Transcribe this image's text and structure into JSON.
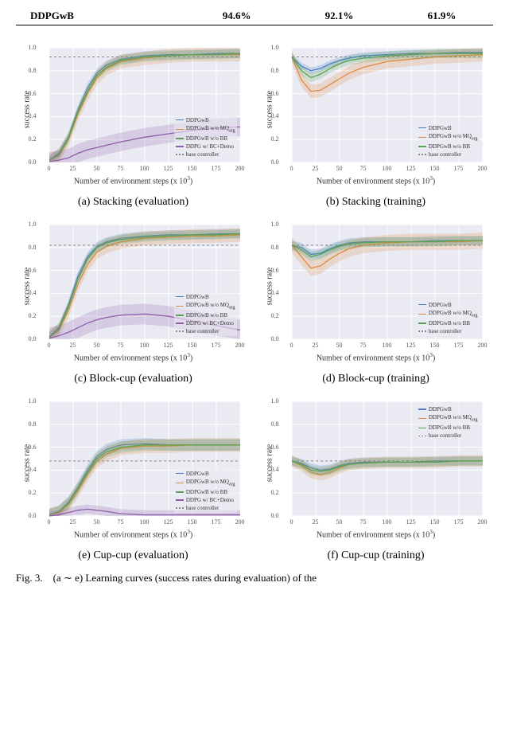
{
  "table": {
    "row1": {
      "label": "DDPGwB",
      "c1": "94.6%",
      "c2": "92.1%",
      "c3": "61.9%"
    }
  },
  "figure_caption_prefix": "Fig. 3.",
  "figure_caption_body": "(a ∼ e) Learning curves (success rates during evaluation) of the",
  "colors": {
    "DDPGwB": "#4a7ec9",
    "DDPGwB_noMQ": "#e08a3d",
    "DDPGwB_noBB": "#5aa253",
    "DDPG_BC": "#8f5eaa",
    "base": "#8a8a8a"
  },
  "legend_labels": {
    "DDPGwB": "DDPGwB",
    "noMQ_1": "DDPGwB w/o MQ",
    "noMQ_suffix": "arg",
    "noBB": "DDPGwB w/o BB",
    "BC": "DDPG w/ BC+Demo",
    "base": "base controller"
  },
  "axis": {
    "ylabel": "success rate",
    "xlabel_1": "Number of environment steps (x 10",
    "xlabel_sup": "3",
    "xlabel_2": ")",
    "yticks": [
      "0.0",
      "0.2",
      "0.4",
      "0.6",
      "0.8",
      "1.0"
    ],
    "xticks": [
      "0",
      "25",
      "50",
      "75",
      "100",
      "125",
      "150",
      "175",
      "200"
    ]
  },
  "chart_data": [
    {
      "id": "a",
      "caption": "(a) Stacking (evaluation)",
      "type": "line",
      "ylim": [
        0,
        1
      ],
      "xlim": [
        0,
        200
      ],
      "base": 0.92,
      "legend_pos": "lower-right",
      "legend_set": "full",
      "x": [
        0,
        10,
        20,
        30,
        40,
        50,
        60,
        75,
        100,
        125,
        150,
        175,
        200
      ],
      "series": [
        {
          "name": "DDPGwB",
          "key": "DDPGwB",
          "values": [
            0.02,
            0.08,
            0.22,
            0.46,
            0.65,
            0.78,
            0.85,
            0.9,
            0.93,
            0.94,
            0.94,
            0.95,
            0.95
          ],
          "band": 0.04
        },
        {
          "name": "DDPGwB w/o MQ_arg",
          "key": "DDPGwB_noMQ",
          "values": [
            0.02,
            0.06,
            0.2,
            0.42,
            0.6,
            0.74,
            0.82,
            0.88,
            0.91,
            0.93,
            0.94,
            0.94,
            0.94
          ],
          "band": 0.06
        },
        {
          "name": "DDPGwB w/o BB",
          "key": "DDPGwB_noBB",
          "values": [
            0.02,
            0.07,
            0.21,
            0.44,
            0.62,
            0.76,
            0.83,
            0.89,
            0.92,
            0.93,
            0.94,
            0.94,
            0.95
          ],
          "band": 0.04
        },
        {
          "name": "DDPG w/ BC+Demo",
          "key": "DDPG_BC",
          "values": [
            0.01,
            0.02,
            0.04,
            0.08,
            0.11,
            0.13,
            0.15,
            0.18,
            0.22,
            0.25,
            0.28,
            0.3,
            0.31
          ],
          "band": 0.08
        }
      ]
    },
    {
      "id": "b",
      "caption": "(b) Stacking (training)",
      "type": "line",
      "ylim": [
        0,
        1
      ],
      "xlim": [
        0,
        200
      ],
      "base": 0.92,
      "legend_pos": "lower-right",
      "legend_set": "ablate",
      "x": [
        0,
        10,
        20,
        30,
        40,
        50,
        60,
        75,
        100,
        125,
        150,
        175,
        200
      ],
      "series": [
        {
          "name": "DDPGwB",
          "key": "DDPGwB",
          "values": [
            0.92,
            0.84,
            0.8,
            0.82,
            0.86,
            0.89,
            0.91,
            0.93,
            0.94,
            0.95,
            0.95,
            0.96,
            0.96
          ],
          "band": 0.03
        },
        {
          "name": "DDPGwB w/o MQ_arg",
          "key": "DDPGwB_noMQ",
          "values": [
            0.92,
            0.72,
            0.62,
            0.63,
            0.68,
            0.73,
            0.78,
            0.83,
            0.88,
            0.9,
            0.92,
            0.93,
            0.94
          ],
          "band": 0.06
        },
        {
          "name": "DDPGwB w/o BB",
          "key": "DDPGwB_noBB",
          "values": [
            0.92,
            0.8,
            0.74,
            0.77,
            0.82,
            0.86,
            0.89,
            0.91,
            0.93,
            0.94,
            0.95,
            0.95,
            0.95
          ],
          "band": 0.04
        }
      ]
    },
    {
      "id": "c",
      "caption": "(c) Block-cup (evaluation)",
      "type": "line",
      "ylim": [
        0,
        1
      ],
      "xlim": [
        0,
        200
      ],
      "base": 0.82,
      "legend_pos": "lower-right",
      "legend_set": "full",
      "x": [
        0,
        10,
        20,
        30,
        40,
        50,
        60,
        75,
        100,
        125,
        150,
        175,
        200
      ],
      "series": [
        {
          "name": "DDPGwB",
          "key": "DDPGwB",
          "values": [
            0.02,
            0.1,
            0.3,
            0.55,
            0.72,
            0.81,
            0.85,
            0.88,
            0.9,
            0.91,
            0.91,
            0.92,
            0.92
          ],
          "band": 0.04
        },
        {
          "name": "DDPGwB w/o MQ_arg",
          "key": "DDPGwB_noMQ",
          "values": [
            0.02,
            0.08,
            0.25,
            0.48,
            0.65,
            0.76,
            0.81,
            0.85,
            0.88,
            0.89,
            0.9,
            0.9,
            0.91
          ],
          "band": 0.06
        },
        {
          "name": "DDPGwB w/o BB",
          "key": "DDPGwB_noBB",
          "values": [
            0.02,
            0.09,
            0.28,
            0.52,
            0.7,
            0.8,
            0.84,
            0.87,
            0.89,
            0.9,
            0.91,
            0.91,
            0.92
          ],
          "band": 0.04
        },
        {
          "name": "DDPG w/ BC+Demo",
          "key": "DDPG_BC",
          "values": [
            0.01,
            0.03,
            0.06,
            0.1,
            0.14,
            0.17,
            0.19,
            0.21,
            0.22,
            0.2,
            0.16,
            0.12,
            0.08
          ],
          "band": 0.09
        }
      ]
    },
    {
      "id": "d",
      "caption": "(d) Block-cup (training)",
      "type": "line",
      "ylim": [
        0,
        1
      ],
      "xlim": [
        0,
        200
      ],
      "base": 0.82,
      "legend_pos": "lower-right",
      "legend_set": "ablate",
      "x": [
        0,
        10,
        20,
        30,
        40,
        50,
        60,
        75,
        100,
        125,
        150,
        175,
        200
      ],
      "series": [
        {
          "name": "DDPGwB",
          "key": "DDPGwB",
          "values": [
            0.82,
            0.8,
            0.74,
            0.75,
            0.79,
            0.82,
            0.84,
            0.85,
            0.85,
            0.85,
            0.86,
            0.86,
            0.86
          ],
          "band": 0.04
        },
        {
          "name": "DDPGwB w/o MQ_arg",
          "key": "DDPGwB_noMQ",
          "values": [
            0.82,
            0.72,
            0.62,
            0.64,
            0.7,
            0.75,
            0.79,
            0.82,
            0.84,
            0.85,
            0.85,
            0.85,
            0.86
          ],
          "band": 0.07
        },
        {
          "name": "DDPGwB w/o BB",
          "key": "DDPGwB_noBB",
          "values": [
            0.82,
            0.78,
            0.72,
            0.74,
            0.78,
            0.81,
            0.83,
            0.84,
            0.85,
            0.85,
            0.85,
            0.86,
            0.86
          ],
          "band": 0.04
        }
      ]
    },
    {
      "id": "e",
      "caption": "(e) Cup-cup (evaluation)",
      "type": "line",
      "ylim": [
        0,
        1
      ],
      "xlim": [
        0,
        200
      ],
      "base": 0.48,
      "legend_pos": "lower-right",
      "legend_set": "full",
      "x": [
        0,
        10,
        20,
        30,
        40,
        50,
        60,
        75,
        100,
        125,
        150,
        175,
        200
      ],
      "series": [
        {
          "name": "DDPGwB",
          "key": "DDPGwB",
          "values": [
            0.01,
            0.04,
            0.12,
            0.25,
            0.4,
            0.52,
            0.58,
            0.62,
            0.63,
            0.62,
            0.62,
            0.62,
            0.62
          ],
          "band": 0.05
        },
        {
          "name": "DDPGwB w/o MQ_arg",
          "key": "DDPGwB_noMQ",
          "values": [
            0.01,
            0.03,
            0.1,
            0.22,
            0.36,
            0.48,
            0.54,
            0.59,
            0.61,
            0.61,
            0.62,
            0.62,
            0.62
          ],
          "band": 0.06
        },
        {
          "name": "DDPGwB w/o BB",
          "key": "DDPGwB_noBB",
          "values": [
            0.01,
            0.04,
            0.11,
            0.24,
            0.38,
            0.5,
            0.56,
            0.6,
            0.62,
            0.62,
            0.62,
            0.62,
            0.62
          ],
          "band": 0.05
        },
        {
          "name": "DDPG w/ BC+Demo",
          "key": "DDPG_BC",
          "values": [
            0.0,
            0.01,
            0.03,
            0.05,
            0.06,
            0.05,
            0.04,
            0.02,
            0.01,
            0.01,
            0.01,
            0.01,
            0.01
          ],
          "band": 0.04
        }
      ]
    },
    {
      "id": "f",
      "caption": "(f) Cup-cup (training)",
      "type": "line",
      "ylim": [
        0,
        1
      ],
      "xlim": [
        0,
        200
      ],
      "base": 0.48,
      "legend_pos": "upper-right",
      "legend_set": "ablate",
      "x": [
        0,
        10,
        20,
        30,
        40,
        50,
        60,
        75,
        100,
        125,
        150,
        175,
        200
      ],
      "series": [
        {
          "name": "DDPGwB",
          "key": "DDPGwB",
          "values": [
            0.48,
            0.46,
            0.42,
            0.4,
            0.41,
            0.44,
            0.46,
            0.47,
            0.47,
            0.47,
            0.48,
            0.48,
            0.48
          ],
          "band": 0.04
        },
        {
          "name": "DDPGwB w/o MQ_arg",
          "key": "DDPGwB_noMQ",
          "values": [
            0.48,
            0.44,
            0.38,
            0.36,
            0.38,
            0.42,
            0.45,
            0.46,
            0.47,
            0.47,
            0.47,
            0.48,
            0.48
          ],
          "band": 0.05
        },
        {
          "name": "DDPGwB w/o BB",
          "key": "DDPGwB_noBB",
          "values": [
            0.48,
            0.45,
            0.4,
            0.39,
            0.4,
            0.43,
            0.45,
            0.46,
            0.47,
            0.47,
            0.47,
            0.48,
            0.48
          ],
          "band": 0.04
        }
      ]
    }
  ]
}
